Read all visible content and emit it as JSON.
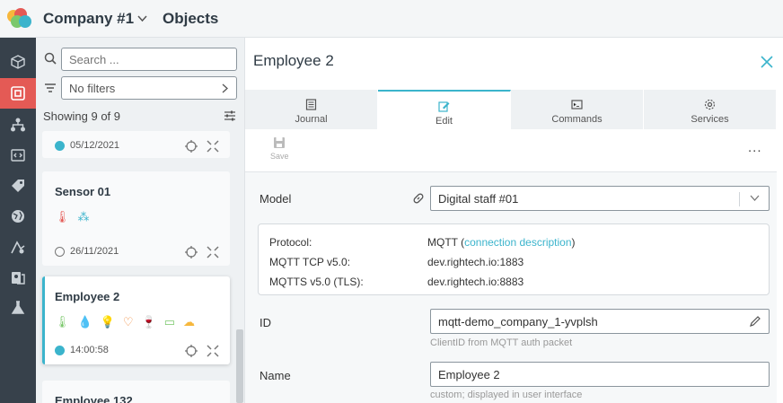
{
  "header": {
    "company": "Company #1",
    "section": "Objects"
  },
  "sidebar": {
    "search_placeholder": "Search ...",
    "filter_label": "No filters",
    "showing": "Showing 9 of 9",
    "cards": [
      {
        "title": "",
        "foot": "05/12/2021"
      },
      {
        "title": "Sensor 01",
        "foot": "26/11/2021"
      },
      {
        "title": "Employee 2",
        "foot": "14:00:58"
      },
      {
        "title": "Employee 132",
        "foot": ""
      }
    ]
  },
  "detail": {
    "title": "Employee 2",
    "tabs": [
      {
        "label": "Journal"
      },
      {
        "label": "Edit"
      },
      {
        "label": "Commands"
      },
      {
        "label": "Services"
      }
    ],
    "save_label": "Save",
    "more": "...",
    "form": {
      "model_label": "Model",
      "model_value": "Digital staff #01",
      "protocol_key": "Protocol:",
      "protocol_value": "MQTT (",
      "protocol_link": "connection description",
      "protocol_close": ")",
      "tcp_key": "MQTT TCP v5.0:",
      "tcp_value": "dev.rightech.io:1883",
      "tls_key": "MQTTS v5.0 (TLS):",
      "tls_value": "dev.rightech.io:8883",
      "id_label": "ID",
      "id_value": "mqtt-demo_company_1-yvplsh",
      "id_hint": "ClientID from MQTT auth packet",
      "name_label": "Name",
      "name_value": "Employee 2",
      "name_hint": "custom; displayed in user interface"
    }
  },
  "colors": {
    "accent": "#3bb4cc",
    "active_rail": "#e45a55",
    "rail": "#37414b"
  }
}
